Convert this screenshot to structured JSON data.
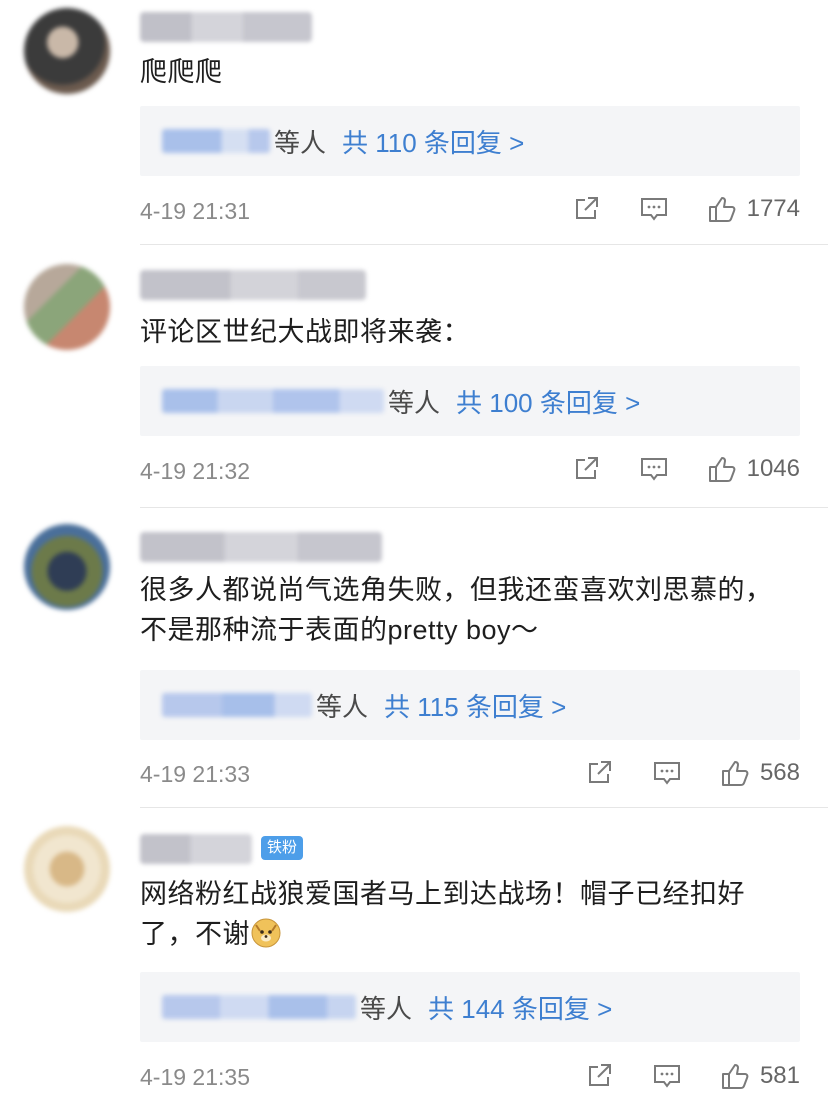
{
  "comments": [
    {
      "content": "爬爬爬",
      "reply_suffix": "等人",
      "reply_total": "共 110 条回复 >",
      "timestamp": "4-19 21:31",
      "likes": "1774",
      "avatar_colors": [
        "#3b3b3b",
        "#c9b8a8",
        "#6b5a4e"
      ],
      "username_color": "#c8c8d0",
      "name_color": "#c3d3ee"
    },
    {
      "content": "评论区世纪大战即将来袭：",
      "reply_suffix": "等人",
      "reply_total": "共 100 条回复 >",
      "timestamp": "4-19 21:32",
      "likes": "1046",
      "avatar_colors": [
        "#b7a89a",
        "#8ba57a",
        "#c78770"
      ],
      "username_color": "#c4c4cc",
      "name_color": "#c3d3ee"
    },
    {
      "content": "很多人都说尚气选角失败，但我还蛮喜欢刘思慕的，不是那种流于表面的pretty boy～",
      "reply_suffix": "等人",
      "reply_total": "共 115 条回复 >",
      "timestamp": "4-19 21:33",
      "likes": "568",
      "avatar_colors": [
        "#4a6f9a",
        "#6c7a4a",
        "#2f3d55"
      ],
      "username_color": "#c4c4cc",
      "name_color": "#c3d3ee"
    },
    {
      "content": "网络粉红战狼爱国者马上到达战场！帽子已经扣好了，不谢",
      "badge": "铁粉",
      "reply_suffix": "等人",
      "reply_total": "共 144 条回复 >",
      "timestamp": "4-19 21:35",
      "likes": "581",
      "avatar_colors": [
        "#e9d9b8",
        "#d8b887",
        "#f1e6cf"
      ],
      "username_color": "#c4c4cc",
      "name_color": "#c3d3ee"
    }
  ],
  "icons": {
    "share": "share-icon",
    "comment": "comment-icon",
    "like": "thumb-up-icon",
    "emoji": "doge-emoji-icon"
  },
  "colors": {
    "link": "#3e7fd0",
    "reply_bg": "#f4f5f7",
    "badge_bg": "#4d9ee9"
  }
}
